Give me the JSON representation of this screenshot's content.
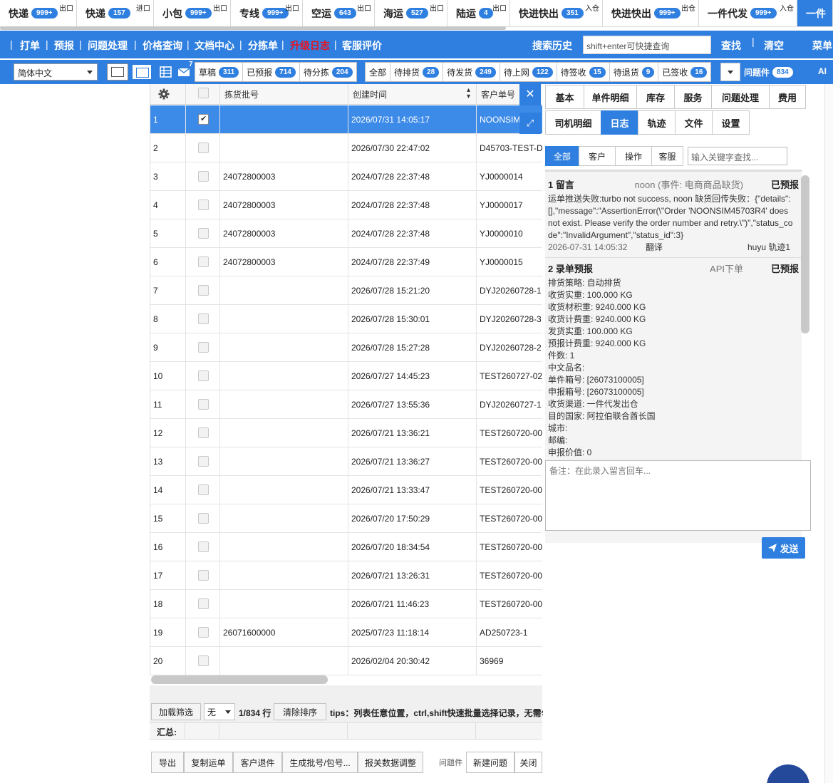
{
  "product_tabs": [
    {
      "label": "快递",
      "count": "999+",
      "tag": "出口"
    },
    {
      "label": "快递",
      "count": "157",
      "tag": "进口"
    },
    {
      "label": "小包",
      "count": "999+",
      "tag": "出口"
    },
    {
      "label": "专线",
      "count": "999+",
      "tag": "出口"
    },
    {
      "label": "空运",
      "count": "643",
      "tag": "出口"
    },
    {
      "label": "海运",
      "count": "527",
      "tag": "出口"
    },
    {
      "label": "陆运",
      "count": "4",
      "tag": "出口"
    },
    {
      "label": "快进快出",
      "count": "351",
      "tag": "入仓"
    },
    {
      "label": "快进快出",
      "count": "999+",
      "tag": "出仓"
    },
    {
      "label": "一件代发",
      "count": "999+",
      "tag": "入仓"
    },
    {
      "label": "一件"
    }
  ],
  "nav": {
    "items": [
      "打单",
      "预报",
      "问题处理",
      "价格查询",
      "文档中心",
      "分拣单",
      "升级日志",
      "客服评价"
    ],
    "search_history": "搜索历史",
    "search_placeholder": "shift+enter可快捷查询",
    "find": "查找",
    "clear": "清空",
    "menu": "菜单",
    "sep": "|"
  },
  "filter": {
    "language": "简体中文",
    "mail_badge": "7",
    "status_group_a": [
      {
        "label": "草稿",
        "count": "311"
      },
      {
        "label": "已预报",
        "count": "714"
      },
      {
        "label": "待分拣",
        "count": "204"
      }
    ],
    "status_group_b": [
      {
        "label": "全部"
      },
      {
        "label": "待排货",
        "count": "28"
      },
      {
        "label": "待发货",
        "count": "249"
      },
      {
        "label": "待上网",
        "count": "122"
      },
      {
        "label": "待签收",
        "count": "15"
      },
      {
        "label": "待退货",
        "count": "9"
      },
      {
        "label": "已签收",
        "count": "16"
      }
    ],
    "issue_tab": {
      "label": "问题件",
      "count": "834"
    },
    "trailing_label": "AI"
  },
  "grid": {
    "columns": [
      "拣货批号",
      "创建时间",
      "客户单号"
    ],
    "rows": [
      {
        "n": "1",
        "batch": "",
        "time": "2026/07/31 14:05:17",
        "cust": "NOONSIM",
        "checked": true
      },
      {
        "n": "2",
        "batch": "",
        "time": "2026/07/30 22:47:02",
        "cust": "D45703-TEST-D"
      },
      {
        "n": "3",
        "batch": "24072800003",
        "time": "2024/07/28 22:37:48",
        "cust": "YJ0000014"
      },
      {
        "n": "4",
        "batch": "24072800003",
        "time": "2024/07/28 22:37:48",
        "cust": "YJ0000017"
      },
      {
        "n": "5",
        "batch": "24072800003",
        "time": "2024/07/28 22:37:48",
        "cust": "YJ0000010"
      },
      {
        "n": "6",
        "batch": "24072800003",
        "time": "2024/07/28 22:37:49",
        "cust": "YJ0000015"
      },
      {
        "n": "7",
        "batch": "",
        "time": "2026/07/28 15:21:20",
        "cust": "DYJ20260728-1"
      },
      {
        "n": "8",
        "batch": "",
        "time": "2026/07/28 15:30:01",
        "cust": "DYJ20260728-3"
      },
      {
        "n": "9",
        "batch": "",
        "time": "2026/07/28 15:27:28",
        "cust": "DYJ20260728-2"
      },
      {
        "n": "10",
        "batch": "",
        "time": "2026/07/27 14:45:23",
        "cust": "TEST260727-02"
      },
      {
        "n": "11",
        "batch": "",
        "time": "2026/07/27 13:55:36",
        "cust": "DYJ20260727-1"
      },
      {
        "n": "12",
        "batch": "",
        "time": "2026/07/21 13:36:21",
        "cust": "TEST260720-00"
      },
      {
        "n": "13",
        "batch": "",
        "time": "2026/07/21 13:36:27",
        "cust": "TEST260720-00"
      },
      {
        "n": "14",
        "batch": "",
        "time": "2026/07/21 13:33:47",
        "cust": "TEST260720-00"
      },
      {
        "n": "15",
        "batch": "",
        "time": "2026/07/20 17:50:29",
        "cust": "TEST260720-00"
      },
      {
        "n": "16",
        "batch": "",
        "time": "2026/07/20 18:34:54",
        "cust": "TEST260720-00"
      },
      {
        "n": "17",
        "batch": "",
        "time": "2026/07/21 13:26:31",
        "cust": "TEST260720-00"
      },
      {
        "n": "18",
        "batch": "",
        "time": "2026/07/21 11:46:23",
        "cust": "TEST260720-00"
      },
      {
        "n": "19",
        "batch": "26071600000",
        "time": "2025/07/23 11:18:14",
        "cust": "AD250723-1"
      },
      {
        "n": "20",
        "batch": "",
        "time": "2026/02/04 20:30:42",
        "cust": "36969"
      }
    ]
  },
  "pager": {
    "load_filter": "加载筛选",
    "filter_value": "无",
    "row_count": "1/834 行",
    "clear_sort": "清除排序",
    "tips": "tips：列表任意位置，ctrl,shift快速批量选择记录，无需勾"
  },
  "summary_label": "汇总:",
  "actions": [
    "导出",
    "复制运单",
    "客户退件",
    "生成批号/包号...",
    "报关数据调整"
  ],
  "actions_right": {
    "label": "问题件",
    "new_issue": "新建问题",
    "close": "关闭"
  },
  "right_panel": {
    "tabs_row1": [
      "基本",
      "单件明细",
      "库存",
      "服务",
      "问题处理",
      "费用"
    ],
    "tabs_row2": [
      "司机明细",
      "日志",
      "轨迹",
      "文件",
      "设置"
    ],
    "filters": [
      "全部",
      "客户",
      "操作",
      "客服"
    ],
    "keyword_placeholder": "输入关键字查找...",
    "log": [
      {
        "title": "1  留言",
        "source": "noon (事件: 电商商品缺货)",
        "status": "已预报",
        "lines": [
          "运单推送失败:turbo not success, noon 缺货回传失败：{\"details\":",
          "[],\"message\":\"AssertionError(\\\"Order 'NOONSIM45703R4' does",
          "not exist. Please verify the order number and retry.\\\")\",\"status_co",
          "de\":\"InvalidArgument\",\"status_id\":3}"
        ],
        "time": "2026-07-31 14:05:32",
        "translate": "翻译",
        "user": "huyu 轨迹1"
      },
      {
        "title": "2  录单预报",
        "source": "API下单",
        "status": "已预报",
        "lines": [
          "排货策略: 自动排货",
          "收货实重: 100.000 KG",
          "收货材积重: 9240.000 KG",
          "收货计费重: 9240.000 KG",
          "发货实重: 100.000 KG",
          "预报计费重: 9240.000 KG",
          "件数: 1",
          "中文品名:",
          "单件箱号: [26073100005]",
          "申报箱号: [26073100005]",
          "收货渠道: 一件代发出仓",
          "目的国家: 阿拉伯联合酋长国",
          "城市:",
          "邮编:",
          "申报价值: 0"
        ]
      }
    ],
    "memo_placeholder": "备注：在此录入留言回车...",
    "send": "发送"
  }
}
